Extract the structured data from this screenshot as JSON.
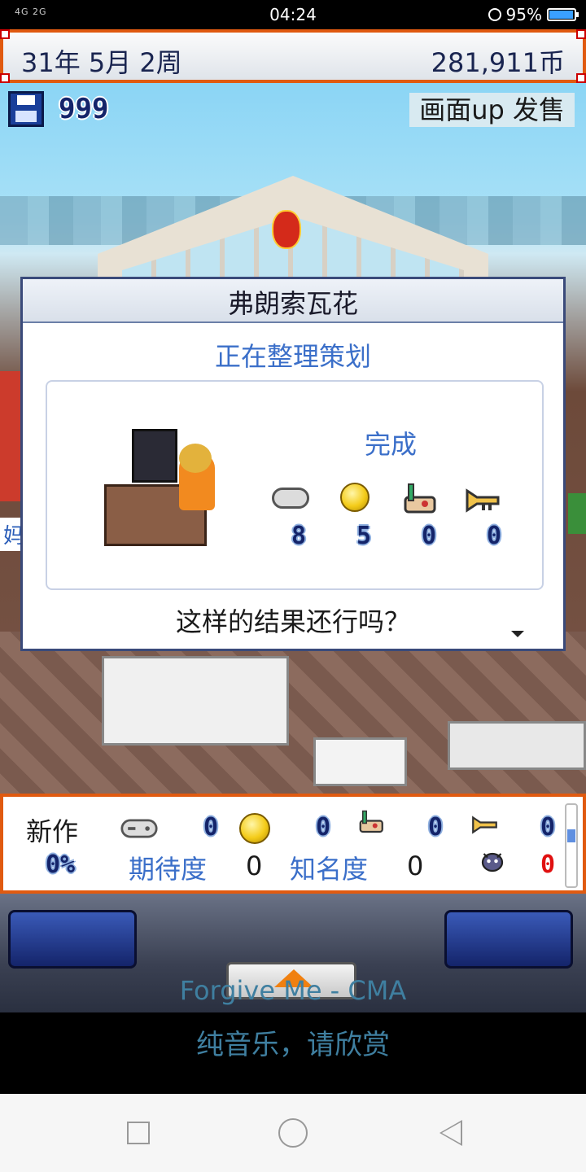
{
  "status_bar": {
    "signal": "4G 2G",
    "time": "04:24",
    "battery": "95%",
    "battery_level": 0.95
  },
  "top_bar": {
    "date": "31年 5月 2周",
    "money": "281,911币"
  },
  "storage": {
    "count": "999"
  },
  "pr_label": "画面up 发售",
  "side_tag": "妈",
  "dialog": {
    "title": "弗朗索瓦花",
    "subtitle": "正在整理策划",
    "result_label": "完成",
    "stats": [
      {
        "icon": "gamepad-icon",
        "value": "8"
      },
      {
        "icon": "coin-icon",
        "value": "5"
      },
      {
        "icon": "paintbrush-icon",
        "value": "0"
      },
      {
        "icon": "trumpet-icon",
        "value": "0"
      }
    ],
    "question": "这样的结果还行吗？"
  },
  "stats_bar": {
    "new_label": "新作",
    "row1": [
      {
        "icon": "gamepad-icon",
        "value": "0"
      },
      {
        "icon": "coin-icon",
        "value": "0"
      },
      {
        "icon": "paintbrush-icon",
        "value": "0"
      },
      {
        "icon": "trumpet-icon",
        "value": "0"
      }
    ],
    "percent": "0%",
    "expectation_label": "期待度",
    "expectation_value": "0",
    "fame_label": "知名度",
    "fame_value": "0",
    "bug_icon": "bug-monster-icon",
    "bug_value": "0"
  },
  "music": {
    "song": "Forgive Me - CMA",
    "note": "纯音乐，请欣赏"
  },
  "colors": {
    "frame_orange": "#e05a10",
    "value_blue": "#14246a",
    "label_blue": "#3b6fc9",
    "bug_red": "#e01010"
  }
}
